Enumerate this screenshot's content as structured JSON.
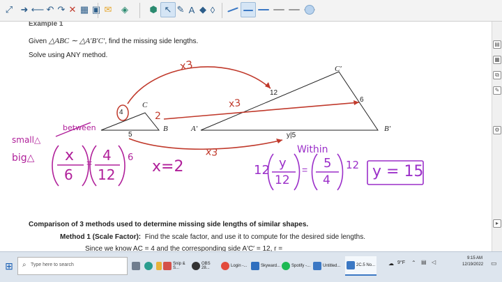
{
  "toolbar": {
    "icons": [
      "expand-icon",
      "forward-arrow-icon",
      "back-arrow-icon",
      "undo-icon",
      "redo-icon",
      "delete-icon",
      "page-sorter-icon",
      "view-icon",
      "notebook-icon",
      "video-icon",
      "capture-icon",
      "select-arrow-icon",
      "pen-icon",
      "text-icon",
      "shapes-icon",
      "eraser-icon",
      "pen-style-1",
      "pen-style-2",
      "pen-style-3",
      "pen-style-4",
      "pen-style-5",
      "pen-style-6",
      "color-swatch-icon"
    ],
    "colors": {
      "accent": "#2c5d8a",
      "pen_red": "#c0392b",
      "pen_blue": "#3b78c4"
    }
  },
  "canvas": {
    "example_title": "Example 1",
    "given_text_1": "Given",
    "given_triangles": "△ABC ∼ △A′B′C′",
    "given_text_2": ", find the missing side lengths.",
    "solve_text": "Solve using ANY method.",
    "small_triangle": {
      "side_ac": "4",
      "vertex_c": "C",
      "vertex_b": "B",
      "side_ab": "5"
    },
    "big_triangle": {
      "vertex_c": "C′",
      "side_ac": "12",
      "side_bc": "6",
      "vertex_a": "A′",
      "vertex_b": "B′",
      "side_ab_unknown": "y|5"
    },
    "ink": {
      "red_x3_top": "x3",
      "red_x3_mid": "x3",
      "red_x3_bottom": "x3",
      "red_side_2": "2",
      "between": "between",
      "small": "small△",
      "big": "big△",
      "eq1_num_left": "x",
      "eq1_den_left": "6",
      "eq1_num_right": "4",
      "eq1_den_right": "12",
      "eq1_mult": "6",
      "eq1_result": "x=2",
      "within": "Within",
      "eq2_mult_left": "12",
      "eq2_num_left": "y",
      "eq2_den_left": "12",
      "eq2_num_right": "5",
      "eq2_den_right": "4",
      "eq2_mult_right": "12",
      "eq2_result": "y = 15"
    },
    "comparison_heading": "Comparison of 3 methods used to determine missing side lengths of similar shapes.",
    "method1_label": "Method 1 (Scale Factor):",
    "method1_text": "Find the scale factor, and use it to compute for the desired side lengths.",
    "since_text": "Since we know AC = 4 and the corresponding side A′C′ = 12,  r ="
  },
  "taskbar": {
    "search_placeholder": "Type here to search",
    "apps": [
      {
        "label": "",
        "icon": "task-view-icon"
      },
      {
        "label": "",
        "icon": "edge-icon"
      },
      {
        "label": "",
        "icon": "file-explorer-icon"
      },
      {
        "label": "",
        "icon": "chrome-icon"
      },
      {
        "label": "Snip & S...",
        "icon": "snip-icon"
      },
      {
        "label": "OBS 28...",
        "icon": "obs-icon"
      },
      {
        "label": "Login -...",
        "icon": "chrome-login-icon"
      },
      {
        "label": "Skyward...",
        "icon": "skyward-icon"
      },
      {
        "label": "Spotify -...",
        "icon": "spotify-icon"
      },
      {
        "label": "Untitled...",
        "icon": "smart-untitled-icon"
      },
      {
        "label": "2C.5 No...",
        "icon": "smart-notebook-icon"
      }
    ],
    "weather": "9°F",
    "time": "9:15 AM",
    "date": "12/19/2022"
  }
}
